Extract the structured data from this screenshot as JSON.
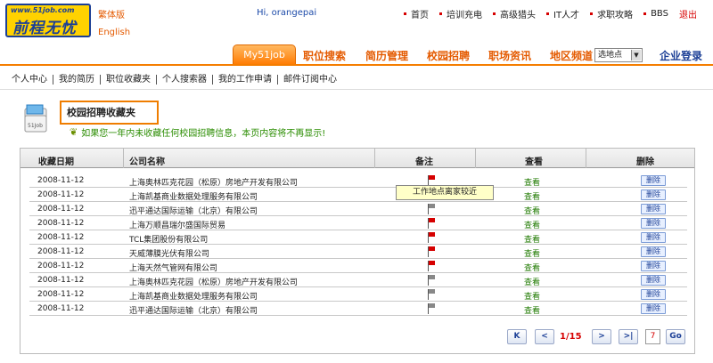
{
  "header": {
    "logo_url": "www.51job.com",
    "logo_text": "前程无忧",
    "lang_traditional": "繁体版",
    "lang_english": "English",
    "greeting": "Hi, orangepai",
    "top_links": [
      "首页",
      "培训充电",
      "高级猎头",
      "IT人才",
      "求职攻略",
      "BBS"
    ],
    "logout": "退出"
  },
  "nav": {
    "my_tab": "My51job",
    "items": [
      "职位搜索",
      "简历管理",
      "校园招聘",
      "职场资讯",
      "地区频道"
    ],
    "location_select": "选地点",
    "login": "企业登录"
  },
  "subnav": [
    "个人中心",
    "我的简历",
    "职位收藏夹",
    "个人搜索器",
    "我的工作申请",
    "邮件订阅中心"
  ],
  "page": {
    "icon_label": "51Job",
    "title": "校园招聘收藏夹",
    "notice": "如果您一年内未收藏任何校园招聘信息，本页内容将不再显示!"
  },
  "table": {
    "headers": {
      "date": "收藏日期",
      "company": "公司名称",
      "note": "备注",
      "view": "查看",
      "delete": "删除"
    },
    "rows": [
      {
        "date": "2008-11-12",
        "company": "上海奥林匹克花园（松原）房地产开发有限公司",
        "flag": "red",
        "view": "查看",
        "delete": "删除"
      },
      {
        "date": "2008-11-12",
        "company": "上海凯基商业数据处理服务有限公司",
        "flag": "gray",
        "view": "查看",
        "delete": "删除"
      },
      {
        "date": "2008-11-12",
        "company": "迅平通达国际运输（北京）有限公司",
        "flag": "gray",
        "view": "查看",
        "delete": "删除"
      },
      {
        "date": "2008-11-12",
        "company": "上海万顺昌瑞尔盛国际贸易",
        "flag": "red",
        "view": "查看",
        "delete": "删除"
      },
      {
        "date": "2008-11-12",
        "company": "TCL集团股份有限公司",
        "flag": "red",
        "view": "查看",
        "delete": "删除"
      },
      {
        "date": "2008-11-12",
        "company": "天威薄膜光伏有限公司",
        "flag": "red",
        "view": "查看",
        "delete": "删除"
      },
      {
        "date": "2008-11-12",
        "company": "上海天然气管网有限公司",
        "flag": "red",
        "view": "查看",
        "delete": "删除"
      },
      {
        "date": "2008-11-12",
        "company": "上海奥林匹克花园（松原）房地产开发有限公司",
        "flag": "gray",
        "view": "查看",
        "delete": "删除"
      },
      {
        "date": "2008-11-12",
        "company": "上海凯基商业数据处理服务有限公司",
        "flag": "gray",
        "view": "查看",
        "delete": "删除"
      },
      {
        "date": "2008-11-12",
        "company": "迅平通达国际运输（北京）有限公司",
        "flag": "gray",
        "view": "查看",
        "delete": "删除"
      }
    ],
    "tooltip": "工作地点离家较近"
  },
  "pager": {
    "first": "K",
    "prev": "<",
    "info": "1/15",
    "next": ">",
    "last": ">|",
    "page_input": "7",
    "go": "Go"
  },
  "colors": {
    "accent": "#f57d00",
    "link_blue": "#1c3f96",
    "view_green": "#1f7a00",
    "flag_red": "#d60000",
    "flag_gray": "#888888"
  },
  "icons": {
    "logo": "51job-logo",
    "folder": "folder-icon",
    "leaf": "leaf-icon",
    "flag": "flag-icon"
  }
}
